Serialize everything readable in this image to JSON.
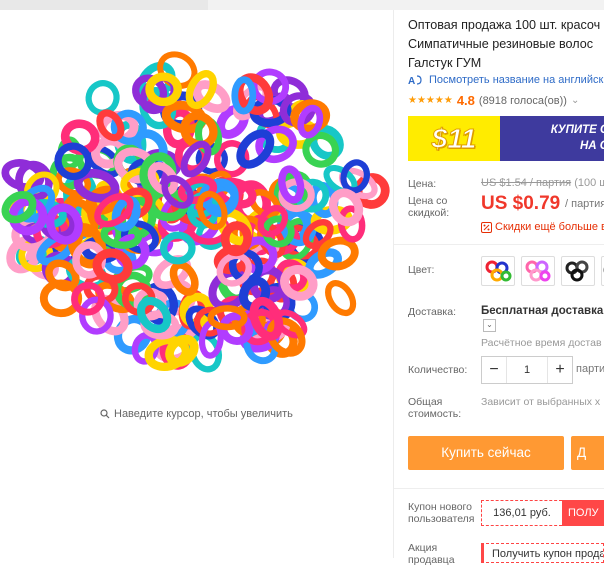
{
  "product": {
    "title_lines": [
      "Оптовая продажа 100 шт. красоч",
      "Симпатичные резиновые волос",
      "Галстук ГУМ"
    ],
    "translate_link": "Посмотреть название на английск",
    "rating_value": "4.8",
    "rating_count": "(8918 голоса(ов))",
    "stars": 5,
    "zoom_hint": "Наведите курсор, чтобы увеличить"
  },
  "banner": {
    "price": "$11",
    "line1": "КУПИТЕ СЕ",
    "line2": "НА СЛ"
  },
  "price": {
    "label": "Цена:",
    "old_value": "US $1.54 / партия",
    "old_suffix": "(100 ш",
    "discount_label_1": "Цена со",
    "discount_label_2": "скидкой:",
    "new_value": "US $0.79",
    "per_lot": "/ партия",
    "discount_note": "Скидки ещё больше в"
  },
  "options": {
    "color_label": "Цвет:",
    "shipping_label": "Доставка:",
    "shipping_value": "Бесплатная доставка в",
    "shipping_time": "Расчётное время достав",
    "quantity_label": "Количество:",
    "quantity_value": "1",
    "quantity_minus": "−",
    "quantity_plus": "+",
    "quantity_unit": "парти",
    "total_label_1": "Общая",
    "total_label_2": "стоимость:",
    "total_value": "Зависит от выбранных х"
  },
  "actions": {
    "buy_now": "Купить сейчас",
    "add_to_cart": "Д"
  },
  "coupons": {
    "new_user_label_1": "Купон нового",
    "new_user_label_2": "пользователя",
    "coupon_value": "136,01 руб.",
    "get_label": "ПОЛУ",
    "store_label_1": "Акция",
    "store_label_2": "продавца",
    "store_coupon": "Получить купон продав"
  },
  "colors": {
    "accent": "#ff9933",
    "price_red": "#f0382b",
    "link_blue": "#2e6bc7",
    "banner_bg": "#3e3a9e",
    "banner_yellow": "#ffec00"
  }
}
